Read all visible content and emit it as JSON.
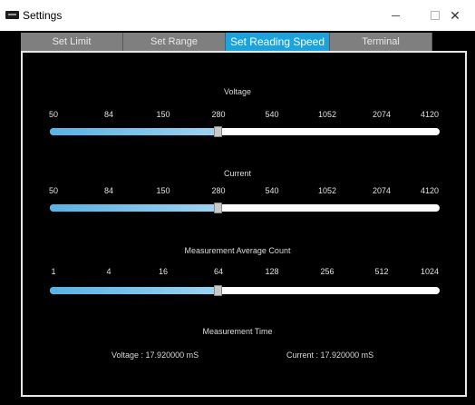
{
  "window": {
    "title": "Settings",
    "minimize_glyph": "—",
    "close_glyph": "✕"
  },
  "tabs": [
    {
      "label": "Set Limit",
      "active": false
    },
    {
      "label": "Set Range",
      "active": false
    },
    {
      "label": "Set Reading Speed",
      "active": true
    },
    {
      "label": "Terminal",
      "active": false
    }
  ],
  "voltage": {
    "title": "Voltage",
    "ticks": [
      "50",
      "84",
      "150",
      "280",
      "540",
      "1052",
      "2074",
      "4120"
    ],
    "selected": "280"
  },
  "current": {
    "title": "Current",
    "ticks": [
      "50",
      "84",
      "150",
      "280",
      "540",
      "1052",
      "2074",
      "4120"
    ],
    "selected": "280"
  },
  "avg_count": {
    "title": "Measurement Average Count",
    "ticks": [
      "1",
      "4",
      "16",
      "64",
      "128",
      "256",
      "512",
      "1024"
    ],
    "selected": "64"
  },
  "measurement_time": {
    "title": "Measurement Time",
    "voltage_label": "Voltage :",
    "voltage_value": "17.920000",
    "voltage_unit": "mS",
    "current_label": "Current :",
    "current_value": "17.920000",
    "current_unit": "mS"
  },
  "colors": {
    "accent": "#1aa3df",
    "slider_fill": "#6cc0ec",
    "tab_inactive": "#7f7f7f",
    "background": "#000000"
  }
}
